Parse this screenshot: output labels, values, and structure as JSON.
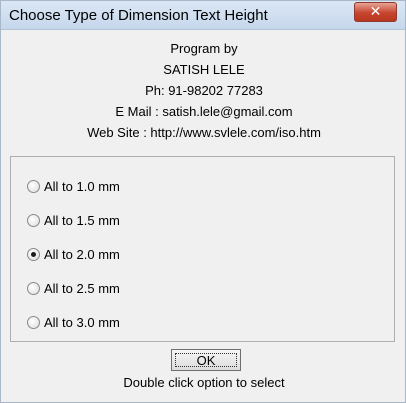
{
  "window": {
    "title": "Choose Type of Dimension Text Height",
    "close_label": "✕"
  },
  "info": {
    "line1": "Program by",
    "line2": "SATISH LELE",
    "line3": "Ph: 91-98202 77283",
    "line4": "E Mail : satish.lele@gmail.com",
    "line5": "Web Site : http://www.svlele.com/iso.htm"
  },
  "options": [
    {
      "label": "All to 1.0 mm",
      "selected": false
    },
    {
      "label": "All to 1.5 mm",
      "selected": false
    },
    {
      "label": "All to 2.0 mm",
      "selected": true
    },
    {
      "label": "All to 2.5 mm",
      "selected": false
    },
    {
      "label": "All to 3.0 mm",
      "selected": false
    }
  ],
  "ok_label": "OK",
  "hint": "Double click option to select"
}
